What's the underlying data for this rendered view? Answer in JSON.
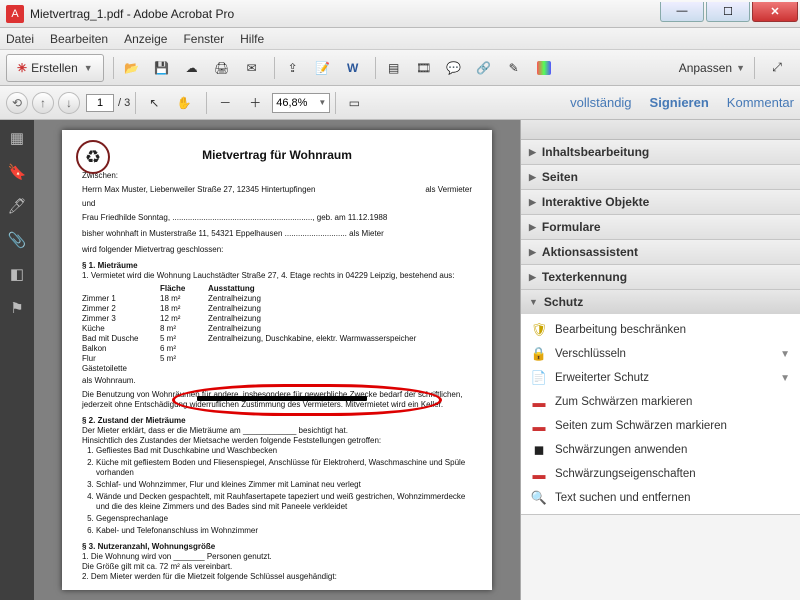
{
  "window": {
    "title": "Mietvertrag_1.pdf - Adobe Acrobat Pro"
  },
  "menu": {
    "items": [
      "Datei",
      "Bearbeiten",
      "Anzeige",
      "Fenster",
      "Hilfe"
    ]
  },
  "toolbar1": {
    "create": "Erstellen",
    "anpassen": "Anpassen"
  },
  "toolbar2": {
    "page_current": "1",
    "page_total": "/ 3",
    "zoom": "46,8%",
    "links": {
      "vollstaendig": "vollständig",
      "signieren": "Signieren",
      "kommentar": "Kommentar"
    }
  },
  "doc": {
    "title": "Mietvertrag für Wohnraum",
    "zwischen": "Zwischen:",
    "vermieter_line": "Herrn Max Muster, Liebenweiler Straße 27, 12345 Hintertupfingen",
    "vermieter_role": "als Vermieter",
    "und": "und",
    "mieter_line": "Frau Friedhilde Sonntag, ..............................................................., geb. am 11.12.1988",
    "bisher": "bisher wohnhaft in Musterstraße 11, 54321 Eppelhausen ............................ als Mieter",
    "folgender": "wird folgender Mietvertrag geschlossen:",
    "p1": "§ 1.   Mieträume",
    "p1_1": "1.   Vermietet wird die Wohnung Lauchstädter Straße 27, 4. Etage rechts in 04229 Leipzig, bestehend aus:",
    "tbl_head": {
      "c2": "Fläche",
      "c3": "Ausstattung"
    },
    "rows": [
      {
        "c1": "Zimmer 1",
        "c2": "18 m²",
        "c3": "Zentralheizung"
      },
      {
        "c1": "Zimmer 2",
        "c2": "18 m²",
        "c3": "Zentralheizung"
      },
      {
        "c1": "Zimmer 3",
        "c2": "12 m²",
        "c3": "Zentralheizung"
      },
      {
        "c1": "Küche",
        "c2": "8 m²",
        "c3": "Zentralheizung"
      },
      {
        "c1": "Bad mit Dusche",
        "c2": "5 m²",
        "c3": "Zentralheizung, Duschkabine, elektr. Warmwasserspeicher"
      },
      {
        "c1": "Balkon",
        "c2": "6 m²",
        "c3": ""
      },
      {
        "c1": "Flur",
        "c2": "5 m²",
        "c3": ""
      },
      {
        "c1": "Gästetoilette",
        "c2": "",
        "c3": ""
      }
    ],
    "als_wohn": "als Wohnraum.",
    "p1_2": "Die Benutzung von Wohnräumen für andere, insbesondere für gewerbliche Zwecke bedarf der schriftlichen, jederzeit ohne Entschädigung widerruflichen Zustimmung des Vermieters. Mitvermietet wird ein Keller.",
    "p2": "§ 2.   Zustand der Mieträume",
    "p2_intro1": "Der Mieter erklärt, dass er die Mieträume am ____________ besichtigt hat.",
    "p2_intro2": "Hinsichtlich des Zustandes der Mietsache werden folgende Feststellungen getroffen:",
    "p2_list": [
      "Gefliestes Bad mit Duschkabine und Waschbecken",
      "Küche mit gefliestem Boden und Fliesenspiegel, Anschlüsse für Elektroherd, Waschmaschine und Spüle vorhanden",
      "Schlaf- und Wohnzimmer, Flur und kleines Zimmer mit Laminat neu verlegt",
      "Wände und Decken gespachtelt, mit Rauhfasertapete tapeziert und weiß gestrichen, Wohnzimmerdecke und die des kleine Zimmers und des Bades sind mit Paneele verkleidet",
      "Gegensprechanlage",
      "Kabel- und Telefonanschluss im Wohnzimmer"
    ],
    "p3": "§ 3.   Nutzeranzahl, Wohnungsgröße",
    "p3_1": "1.   Die Wohnung wird von _______ Personen genutzt.",
    "p3_2": "     Die Größe gilt mit ca. 72 m² als vereinbart.",
    "p3_3": "2.   Dem Mieter werden für die Mietzeit folgende Schlüssel ausgehändigt:"
  },
  "panels": {
    "closed": [
      "Inhaltsbearbeitung",
      "Seiten",
      "Interaktive Objekte",
      "Formulare",
      "Aktionsassistent",
      "Texterkennung"
    ],
    "open_title": "Schutz",
    "open_items": [
      {
        "icon": "shield",
        "label": "Bearbeitung beschränken",
        "chev": false
      },
      {
        "icon": "lock",
        "label": "Verschlüsseln",
        "chev": true
      },
      {
        "icon": "doc",
        "label": "Erweiterter Schutz",
        "chev": true
      },
      {
        "icon": "red",
        "label": "Zum Schwärzen markieren",
        "chev": false
      },
      {
        "icon": "red",
        "label": "Seiten zum Schwärzen markieren",
        "chev": false
      },
      {
        "icon": "black",
        "label": "Schwärzungen anwenden",
        "chev": false
      },
      {
        "icon": "red",
        "label": "Schwärzungseigenschaften",
        "chev": false
      },
      {
        "icon": "search",
        "label": "Text suchen und entfernen",
        "chev": false
      }
    ]
  }
}
